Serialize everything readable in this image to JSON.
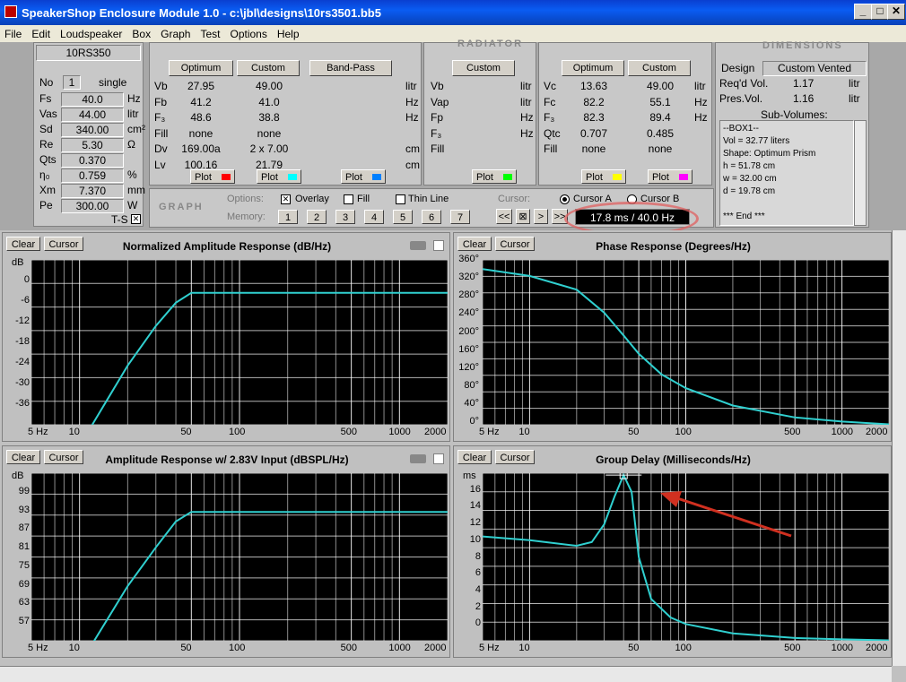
{
  "window": {
    "title": "SpeakerShop Enclosure Module 1.0 - c:\\jbl\\designs\\10rs3501.bb5"
  },
  "menu": [
    "File",
    "Edit",
    "Loudspeaker",
    "Box",
    "Graph",
    "Test",
    "Options",
    "Help"
  ],
  "ts": {
    "model": "10RS350",
    "no_label": "No",
    "no_val": "1",
    "config": "single",
    "rows": [
      {
        "name": "Fs",
        "val": "40.0",
        "unit": "Hz"
      },
      {
        "name": "Vas",
        "val": "44.00",
        "unit": "litr"
      },
      {
        "name": "Sd",
        "val": "340.00",
        "unit": "cm²"
      },
      {
        "name": "Re",
        "val": "5.30",
        "unit": "Ω"
      },
      {
        "name": "Qts",
        "val": "0.370",
        "unit": ""
      },
      {
        "name": "η₀",
        "val": "0.759",
        "unit": "%"
      },
      {
        "name": "Xm",
        "val": "7.370",
        "unit": "mm"
      },
      {
        "name": "Pe",
        "val": "300.00",
        "unit": "W"
      }
    ],
    "ts_label": "T-S"
  },
  "box": {
    "buttons": [
      "Optimum",
      "Custom",
      "Band-Pass"
    ],
    "labels": [
      "Vb",
      "Fb",
      "F₃",
      "Fill",
      "Dv",
      "Lv"
    ],
    "optimum": [
      "27.95",
      "41.2",
      "48.6",
      "none",
      "169.00a",
      "100.16"
    ],
    "custom": [
      "49.00",
      "41.0",
      "38.8",
      "none",
      "2 x 7.00",
      "21.79"
    ],
    "units": [
      "litr",
      "Hz",
      "Hz",
      "",
      "cm",
      "cm"
    ],
    "plot": "Plot"
  },
  "radiator": {
    "header": "RADIATOR",
    "button": "Custom",
    "labels": [
      "Vb",
      "Vap",
      "Fp",
      "F₃",
      "Fill"
    ],
    "units": [
      "litr",
      "litr",
      "Hz",
      "Hz",
      ""
    ],
    "plot": "Plot"
  },
  "closed": {
    "buttons": [
      "Optimum",
      "Custom"
    ],
    "labels": [
      "Vc",
      "Fc",
      "F₃",
      "Qtc",
      "Fill"
    ],
    "optimum": [
      "13.63",
      "82.2",
      "82.3",
      "0.707",
      "none"
    ],
    "custom": [
      "49.00",
      "55.1",
      "89.4",
      "0.485",
      "none"
    ],
    "units": [
      "litr",
      "Hz",
      "Hz",
      "",
      ""
    ],
    "plot": "Plot"
  },
  "dims": {
    "header": "DIMENSIONS",
    "design_label": "Design",
    "design_val": "Custom Vented",
    "reqd_label": "Req'd Vol.",
    "reqd_val": "1.17",
    "reqd_unit": "litr",
    "pres_label": "Pres.Vol.",
    "pres_val": "1.16",
    "pres_unit": "litr",
    "sub_label": "Sub-Volumes:",
    "lines": [
      "--BOX1--",
      "Vol = 32.77 liters",
      "Shape: Optimum Prism",
      "h = 51.78 cm",
      "w = 32.00 cm",
      "d = 19.78 cm",
      "",
      "*** End ***"
    ]
  },
  "graphbar": {
    "label": "GRAPH",
    "options_label": "Options:",
    "overlay": "Overlay",
    "fill": "Fill",
    "thin": "Thin Line",
    "memory_label": "Memory:",
    "memory": [
      "1",
      "2",
      "3",
      "4",
      "5",
      "6",
      "7"
    ],
    "cursor_label": "Cursor:",
    "cursor_a": "Cursor A",
    "cursor_b": "Cursor B",
    "nav": [
      "<<",
      "⊠",
      ">",
      ">>"
    ],
    "readout": "17.8 ms / 40.0 Hz"
  },
  "graphs": [
    {
      "title": "Normalized Amplitude Response (dB/Hz)",
      "unit": "dB",
      "ylabels": [
        "0",
        "-6",
        "-12",
        "-18",
        "-24",
        "-30",
        "-36"
      ],
      "xlabels": [
        "5 Hz",
        "10",
        "50",
        "100",
        "500",
        "1000",
        "2000"
      ],
      "clear": "Clear",
      "cursor": "Cursor"
    },
    {
      "title": "Phase Response (Degrees/Hz)",
      "unit": "",
      "ylabels": [
        "360°",
        "320°",
        "280°",
        "240°",
        "200°",
        "160°",
        "120°",
        "80°",
        "40°",
        "0°"
      ],
      "xlabels": [
        "5 Hz",
        "10",
        "50",
        "100",
        "500",
        "1000",
        "2000"
      ],
      "clear": "Clear",
      "cursor": "Cursor"
    },
    {
      "title": "Amplitude Response w/ 2.83V Input (dBSPL/Hz)",
      "unit": "dB",
      "ylabels": [
        "99",
        "93",
        "87",
        "81",
        "75",
        "69",
        "63",
        "57"
      ],
      "xlabels": [
        "5 Hz",
        "10",
        "50",
        "100",
        "500",
        "1000",
        "2000"
      ],
      "clear": "Clear",
      "cursor": "Cursor"
    },
    {
      "title": "Group Delay (Milliseconds/Hz)",
      "unit": "ms",
      "ylabels": [
        "16",
        "14",
        "12",
        "10",
        "8",
        "6",
        "4",
        "2",
        "0"
      ],
      "xlabels": [
        "5 Hz",
        "10",
        "50",
        "100",
        "500",
        "1000",
        "2000"
      ],
      "clear": "Clear",
      "cursor": "Cursor"
    }
  ],
  "colors": {
    "trace": "#30d0d0",
    "annotation": "#e03020",
    "plot_red": "#ff0000",
    "plot_cyan": "#00ffff",
    "plot_blue": "#0080ff",
    "plot_green": "#00ff00",
    "plot_yellow": "#ffff00",
    "plot_magenta": "#ff00ff"
  }
}
